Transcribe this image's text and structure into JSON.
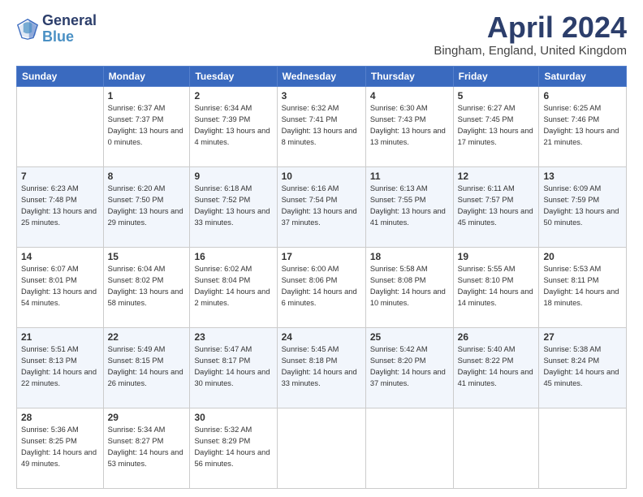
{
  "header": {
    "logo_line1": "General",
    "logo_line2": "Blue",
    "month_title": "April 2024",
    "location": "Bingham, England, United Kingdom"
  },
  "weekdays": [
    "Sunday",
    "Monday",
    "Tuesday",
    "Wednesday",
    "Thursday",
    "Friday",
    "Saturday"
  ],
  "weeks": [
    [
      {
        "day": "",
        "sunrise": "",
        "sunset": "",
        "daylight": ""
      },
      {
        "day": "1",
        "sunrise": "Sunrise: 6:37 AM",
        "sunset": "Sunset: 7:37 PM",
        "daylight": "Daylight: 13 hours and 0 minutes."
      },
      {
        "day": "2",
        "sunrise": "Sunrise: 6:34 AM",
        "sunset": "Sunset: 7:39 PM",
        "daylight": "Daylight: 13 hours and 4 minutes."
      },
      {
        "day": "3",
        "sunrise": "Sunrise: 6:32 AM",
        "sunset": "Sunset: 7:41 PM",
        "daylight": "Daylight: 13 hours and 8 minutes."
      },
      {
        "day": "4",
        "sunrise": "Sunrise: 6:30 AM",
        "sunset": "Sunset: 7:43 PM",
        "daylight": "Daylight: 13 hours and 13 minutes."
      },
      {
        "day": "5",
        "sunrise": "Sunrise: 6:27 AM",
        "sunset": "Sunset: 7:45 PM",
        "daylight": "Daylight: 13 hours and 17 minutes."
      },
      {
        "day": "6",
        "sunrise": "Sunrise: 6:25 AM",
        "sunset": "Sunset: 7:46 PM",
        "daylight": "Daylight: 13 hours and 21 minutes."
      }
    ],
    [
      {
        "day": "7",
        "sunrise": "Sunrise: 6:23 AM",
        "sunset": "Sunset: 7:48 PM",
        "daylight": "Daylight: 13 hours and 25 minutes."
      },
      {
        "day": "8",
        "sunrise": "Sunrise: 6:20 AM",
        "sunset": "Sunset: 7:50 PM",
        "daylight": "Daylight: 13 hours and 29 minutes."
      },
      {
        "day": "9",
        "sunrise": "Sunrise: 6:18 AM",
        "sunset": "Sunset: 7:52 PM",
        "daylight": "Daylight: 13 hours and 33 minutes."
      },
      {
        "day": "10",
        "sunrise": "Sunrise: 6:16 AM",
        "sunset": "Sunset: 7:54 PM",
        "daylight": "Daylight: 13 hours and 37 minutes."
      },
      {
        "day": "11",
        "sunrise": "Sunrise: 6:13 AM",
        "sunset": "Sunset: 7:55 PM",
        "daylight": "Daylight: 13 hours and 41 minutes."
      },
      {
        "day": "12",
        "sunrise": "Sunrise: 6:11 AM",
        "sunset": "Sunset: 7:57 PM",
        "daylight": "Daylight: 13 hours and 45 minutes."
      },
      {
        "day": "13",
        "sunrise": "Sunrise: 6:09 AM",
        "sunset": "Sunset: 7:59 PM",
        "daylight": "Daylight: 13 hours and 50 minutes."
      }
    ],
    [
      {
        "day": "14",
        "sunrise": "Sunrise: 6:07 AM",
        "sunset": "Sunset: 8:01 PM",
        "daylight": "Daylight: 13 hours and 54 minutes."
      },
      {
        "day": "15",
        "sunrise": "Sunrise: 6:04 AM",
        "sunset": "Sunset: 8:02 PM",
        "daylight": "Daylight: 13 hours and 58 minutes."
      },
      {
        "day": "16",
        "sunrise": "Sunrise: 6:02 AM",
        "sunset": "Sunset: 8:04 PM",
        "daylight": "Daylight: 14 hours and 2 minutes."
      },
      {
        "day": "17",
        "sunrise": "Sunrise: 6:00 AM",
        "sunset": "Sunset: 8:06 PM",
        "daylight": "Daylight: 14 hours and 6 minutes."
      },
      {
        "day": "18",
        "sunrise": "Sunrise: 5:58 AM",
        "sunset": "Sunset: 8:08 PM",
        "daylight": "Daylight: 14 hours and 10 minutes."
      },
      {
        "day": "19",
        "sunrise": "Sunrise: 5:55 AM",
        "sunset": "Sunset: 8:10 PM",
        "daylight": "Daylight: 14 hours and 14 minutes."
      },
      {
        "day": "20",
        "sunrise": "Sunrise: 5:53 AM",
        "sunset": "Sunset: 8:11 PM",
        "daylight": "Daylight: 14 hours and 18 minutes."
      }
    ],
    [
      {
        "day": "21",
        "sunrise": "Sunrise: 5:51 AM",
        "sunset": "Sunset: 8:13 PM",
        "daylight": "Daylight: 14 hours and 22 minutes."
      },
      {
        "day": "22",
        "sunrise": "Sunrise: 5:49 AM",
        "sunset": "Sunset: 8:15 PM",
        "daylight": "Daylight: 14 hours and 26 minutes."
      },
      {
        "day": "23",
        "sunrise": "Sunrise: 5:47 AM",
        "sunset": "Sunset: 8:17 PM",
        "daylight": "Daylight: 14 hours and 30 minutes."
      },
      {
        "day": "24",
        "sunrise": "Sunrise: 5:45 AM",
        "sunset": "Sunset: 8:18 PM",
        "daylight": "Daylight: 14 hours and 33 minutes."
      },
      {
        "day": "25",
        "sunrise": "Sunrise: 5:42 AM",
        "sunset": "Sunset: 8:20 PM",
        "daylight": "Daylight: 14 hours and 37 minutes."
      },
      {
        "day": "26",
        "sunrise": "Sunrise: 5:40 AM",
        "sunset": "Sunset: 8:22 PM",
        "daylight": "Daylight: 14 hours and 41 minutes."
      },
      {
        "day": "27",
        "sunrise": "Sunrise: 5:38 AM",
        "sunset": "Sunset: 8:24 PM",
        "daylight": "Daylight: 14 hours and 45 minutes."
      }
    ],
    [
      {
        "day": "28",
        "sunrise": "Sunrise: 5:36 AM",
        "sunset": "Sunset: 8:25 PM",
        "daylight": "Daylight: 14 hours and 49 minutes."
      },
      {
        "day": "29",
        "sunrise": "Sunrise: 5:34 AM",
        "sunset": "Sunset: 8:27 PM",
        "daylight": "Daylight: 14 hours and 53 minutes."
      },
      {
        "day": "30",
        "sunrise": "Sunrise: 5:32 AM",
        "sunset": "Sunset: 8:29 PM",
        "daylight": "Daylight: 14 hours and 56 minutes."
      },
      {
        "day": "",
        "sunrise": "",
        "sunset": "",
        "daylight": ""
      },
      {
        "day": "",
        "sunrise": "",
        "sunset": "",
        "daylight": ""
      },
      {
        "day": "",
        "sunrise": "",
        "sunset": "",
        "daylight": ""
      },
      {
        "day": "",
        "sunrise": "",
        "sunset": "",
        "daylight": ""
      }
    ]
  ]
}
